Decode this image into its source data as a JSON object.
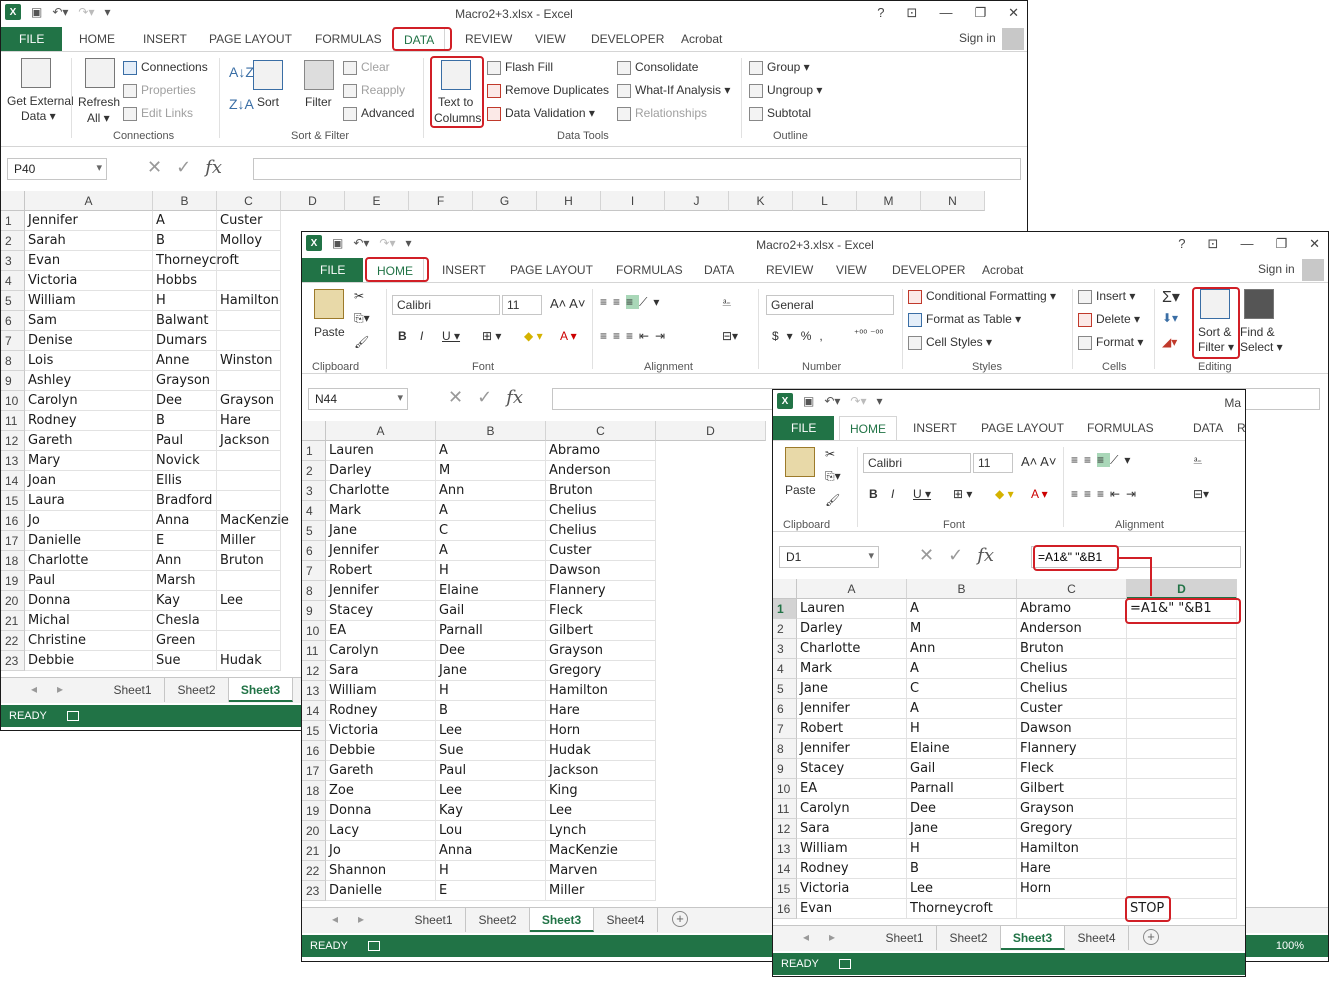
{
  "app": {
    "brand_color": "#217346",
    "highlight_color": "#d11f26"
  },
  "win1": {
    "title": "Macro2+3.xlsx - Excel",
    "tabs": [
      "FILE",
      "HOME",
      "INSERT",
      "PAGE LAYOUT",
      "FORMULAS",
      "DATA",
      "REVIEW",
      "VIEW",
      "DEVELOPER",
      "Acrobat"
    ],
    "active_tab": "DATA",
    "signin": "Sign in",
    "ribbon": {
      "get_external": "Get External",
      "get_external2": "Data ▾",
      "refresh": "Refresh",
      "refresh2": "All ▾",
      "connections": "Connections",
      "properties": "Properties",
      "edit_links": "Edit Links",
      "sort": "Sort",
      "filter": "Filter",
      "clear": "Clear",
      "reapply": "Reapply",
      "advanced": "Advanced",
      "text_to": "Text to",
      "columns": "Columns",
      "flash_fill": "Flash Fill",
      "remove_dup": "Remove Duplicates",
      "data_validation": "Data Validation ▾",
      "consolidate": "Consolidate",
      "what_if": "What-If Analysis ▾",
      "relationships": "Relationships",
      "group": "Group ▾",
      "ungroup": "Ungroup ▾",
      "subtotal": "Subtotal",
      "g_connections": "Connections",
      "g_sortfilter": "Sort & Filter",
      "g_datatools": "Data Tools",
      "g_outline": "Outline"
    },
    "namebox": "P40",
    "cols": [
      "A",
      "B",
      "C",
      "D",
      "E",
      "F",
      "G",
      "H",
      "I",
      "J",
      "K",
      "L",
      "M",
      "N"
    ],
    "rows": [
      [
        "1",
        "Jennifer",
        "A",
        "Custer"
      ],
      [
        "2",
        "Sarah",
        "B",
        "Molloy"
      ],
      [
        "3",
        "Evan",
        "Thorneycroft",
        ""
      ],
      [
        "4",
        "Victoria",
        "Hobbs",
        ""
      ],
      [
        "5",
        "William",
        "H",
        "Hamilton"
      ],
      [
        "6",
        "Sam",
        "Balwant",
        ""
      ],
      [
        "7",
        "Denise",
        "Dumars",
        ""
      ],
      [
        "8",
        "Lois",
        "Anne",
        "Winston"
      ],
      [
        "9",
        "Ashley",
        "Grayson",
        ""
      ],
      [
        "10",
        "Carolyn",
        "Dee",
        "Grayson"
      ],
      [
        "11",
        "Rodney",
        "B",
        "Hare"
      ],
      [
        "12",
        "Gareth",
        "Paul",
        "Jackson"
      ],
      [
        "13",
        "Mary",
        "Novick",
        ""
      ],
      [
        "14",
        "Joan",
        "Ellis",
        ""
      ],
      [
        "15",
        "Laura",
        "Bradford",
        ""
      ],
      [
        "16",
        "Jo",
        "Anna",
        "MacKenzie"
      ],
      [
        "17",
        "Danielle",
        "E",
        "Miller"
      ],
      [
        "18",
        "Charlotte",
        "Ann",
        "Bruton"
      ],
      [
        "19",
        "Paul",
        "Marsh",
        ""
      ],
      [
        "20",
        "Donna",
        "Kay",
        "Lee"
      ],
      [
        "21",
        "Michal",
        "Chesla",
        ""
      ],
      [
        "22",
        "Christine",
        "Green",
        ""
      ],
      [
        "23",
        "Debbie",
        "Sue",
        "Hudak"
      ]
    ],
    "sheets": [
      "Sheet1",
      "Sheet2",
      "Sheet3"
    ],
    "active_sheet": "Sheet3",
    "status": "READY"
  },
  "win2": {
    "title": "Macro2+3.xlsx - Excel",
    "tabs": [
      "FILE",
      "HOME",
      "INSERT",
      "PAGE LAYOUT",
      "FORMULAS",
      "DATA",
      "REVIEW",
      "VIEW",
      "DEVELOPER",
      "Acrobat"
    ],
    "active_tab": "HOME",
    "signin": "Sign in",
    "ribbon": {
      "paste": "Paste",
      "font_name": "Calibri",
      "font_size": "11",
      "number_format": "General",
      "cond_fmt": "Conditional Formatting ▾",
      "fmt_table": "Format as Table ▾",
      "cell_styles": "Cell Styles ▾",
      "insert": "Insert ▾",
      "delete": "Delete ▾",
      "format": "Format ▾",
      "sort_filter": "Sort &",
      "sort_filter2": "Filter ▾",
      "find_select": "Find &",
      "find_select2": "Select ▾",
      "g_clipboard": "Clipboard",
      "g_font": "Font",
      "g_alignment": "Alignment",
      "g_number": "Number",
      "g_styles": "Styles",
      "g_cells": "Cells",
      "g_editing": "Editing"
    },
    "namebox": "N44",
    "cols": [
      "A",
      "B",
      "C",
      "D"
    ],
    "rows": [
      [
        "1",
        "Lauren",
        "A",
        "Abramo"
      ],
      [
        "2",
        "Darley",
        "M",
        "Anderson"
      ],
      [
        "3",
        "Charlotte",
        "Ann",
        "Bruton"
      ],
      [
        "4",
        "Mark",
        "A",
        "Chelius"
      ],
      [
        "5",
        "Jane",
        "C",
        "Chelius"
      ],
      [
        "6",
        "Jennifer",
        "A",
        "Custer"
      ],
      [
        "7",
        "Robert",
        "H",
        "Dawson"
      ],
      [
        "8",
        "Jennifer",
        "Elaine",
        "Flannery"
      ],
      [
        "9",
        "Stacey",
        "Gail",
        "Fleck"
      ],
      [
        "10",
        "EA",
        "Parnall",
        "Gilbert"
      ],
      [
        "11",
        "Carolyn",
        "Dee",
        "Grayson"
      ],
      [
        "12",
        "Sara",
        "Jane",
        "Gregory"
      ],
      [
        "13",
        "William",
        "H",
        "Hamilton"
      ],
      [
        "14",
        "Rodney",
        "B",
        "Hare"
      ],
      [
        "15",
        "Victoria",
        "Lee",
        "Horn"
      ],
      [
        "16",
        "Debbie",
        "Sue",
        "Hudak"
      ],
      [
        "17",
        "Gareth",
        "Paul",
        "Jackson"
      ],
      [
        "18",
        "Zoe",
        "Lee",
        "King"
      ],
      [
        "19",
        "Donna",
        "Kay",
        "Lee"
      ],
      [
        "20",
        "Lacy",
        "Lou",
        "Lynch"
      ],
      [
        "21",
        "Jo",
        "Anna",
        "MacKenzie"
      ],
      [
        "22",
        "Shannon",
        "H",
        "Marven"
      ],
      [
        "23",
        "Danielle",
        "E",
        "Miller"
      ]
    ],
    "sheets": [
      "Sheet1",
      "Sheet2",
      "Sheet3",
      "Sheet4"
    ],
    "active_sheet": "Sheet3",
    "status": "READY",
    "zoom": "100%"
  },
  "win3": {
    "title": "Ma",
    "tabs": [
      "FILE",
      "HOME",
      "INSERT",
      "PAGE LAYOUT",
      "FORMULAS",
      "DATA",
      "RI"
    ],
    "active_tab": "HOME",
    "ribbon": {
      "paste": "Paste",
      "font_name": "Calibri",
      "font_size": "11",
      "g_clipboard": "Clipboard",
      "g_font": "Font",
      "g_alignment": "Alignment"
    },
    "namebox": "D1",
    "formula": "=A1&\" \"&B1",
    "cols": [
      "A",
      "B",
      "C",
      "D"
    ],
    "rows": [
      [
        "1",
        "Lauren",
        "A",
        "Abramo",
        "=A1&\" \"&B1"
      ],
      [
        "2",
        "Darley",
        "M",
        "Anderson",
        ""
      ],
      [
        "3",
        "Charlotte",
        "Ann",
        "Bruton",
        ""
      ],
      [
        "4",
        "Mark",
        "A",
        "Chelius",
        ""
      ],
      [
        "5",
        "Jane",
        "C",
        "Chelius",
        ""
      ],
      [
        "6",
        "Jennifer",
        "A",
        "Custer",
        ""
      ],
      [
        "7",
        "Robert",
        "H",
        "Dawson",
        ""
      ],
      [
        "8",
        "Jennifer",
        "Elaine",
        "Flannery",
        ""
      ],
      [
        "9",
        "Stacey",
        "Gail",
        "Fleck",
        ""
      ],
      [
        "10",
        "EA",
        "Parnall",
        "Gilbert",
        ""
      ],
      [
        "11",
        "Carolyn",
        "Dee",
        "Grayson",
        ""
      ],
      [
        "12",
        "Sara",
        "Jane",
        "Gregory",
        ""
      ],
      [
        "13",
        "William",
        "H",
        "Hamilton",
        ""
      ],
      [
        "14",
        "Rodney",
        "B",
        "Hare",
        ""
      ],
      [
        "15",
        "Victoria",
        "Lee",
        "Horn",
        ""
      ],
      [
        "16",
        "Evan",
        "Thorneycroft",
        "",
        "STOP"
      ]
    ],
    "sheets": [
      "Sheet1",
      "Sheet2",
      "Sheet3",
      "Sheet4"
    ],
    "active_sheet": "Sheet3",
    "status": "READY"
  }
}
